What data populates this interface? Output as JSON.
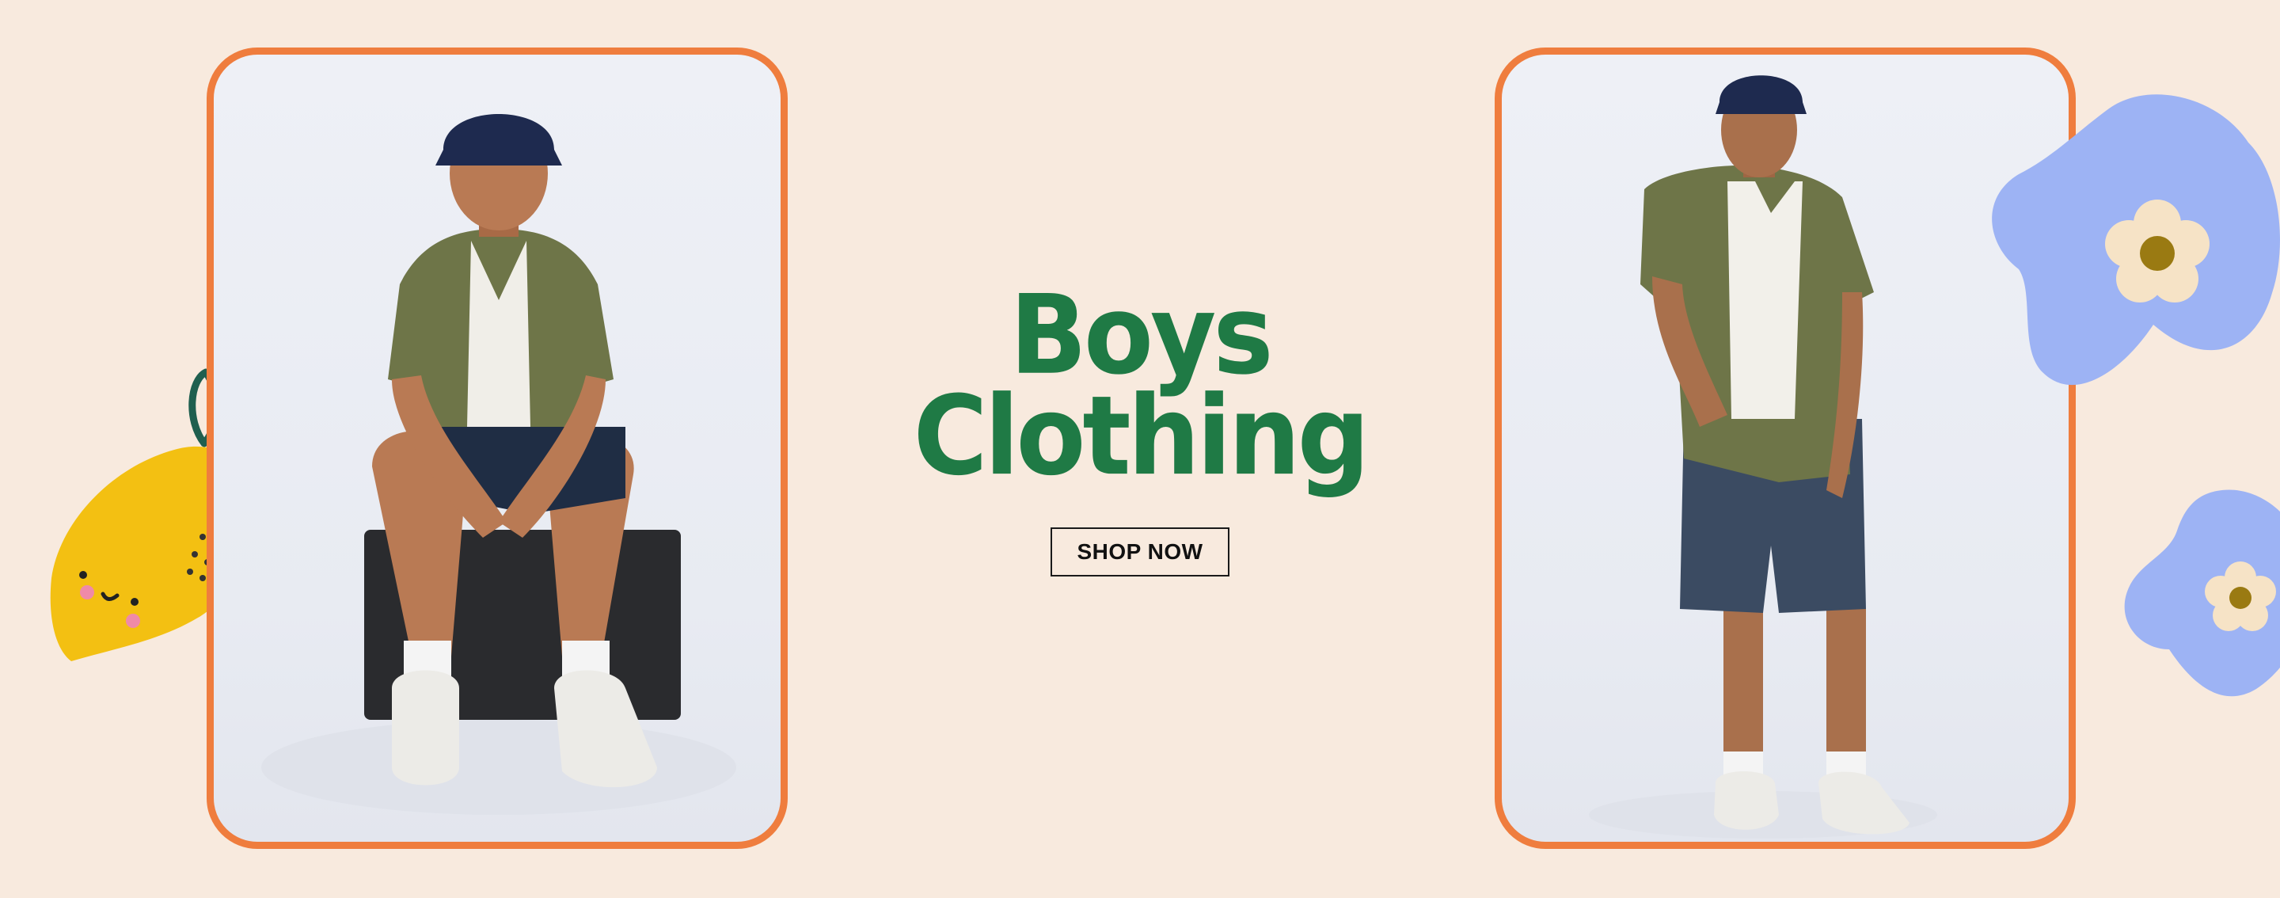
{
  "banner": {
    "headline_line1": "Boys",
    "headline_line2": "Clothing",
    "cta_label": "SHOP NOW"
  },
  "images": {
    "left_photo": "boy-sitting-photo",
    "right_photo": "boy-standing-photo"
  },
  "decorations": {
    "lemon": "lemon-illustration",
    "flowers": "flower-illustration"
  },
  "colors": {
    "background": "#f8eade",
    "frame_border": "#ef7d3e",
    "headline": "#1f7a45",
    "lemon": "#f3c012",
    "flower_blob": "#9db3f4",
    "flower_petal": "#f6e3c6",
    "flower_center": "#9a7a12"
  }
}
